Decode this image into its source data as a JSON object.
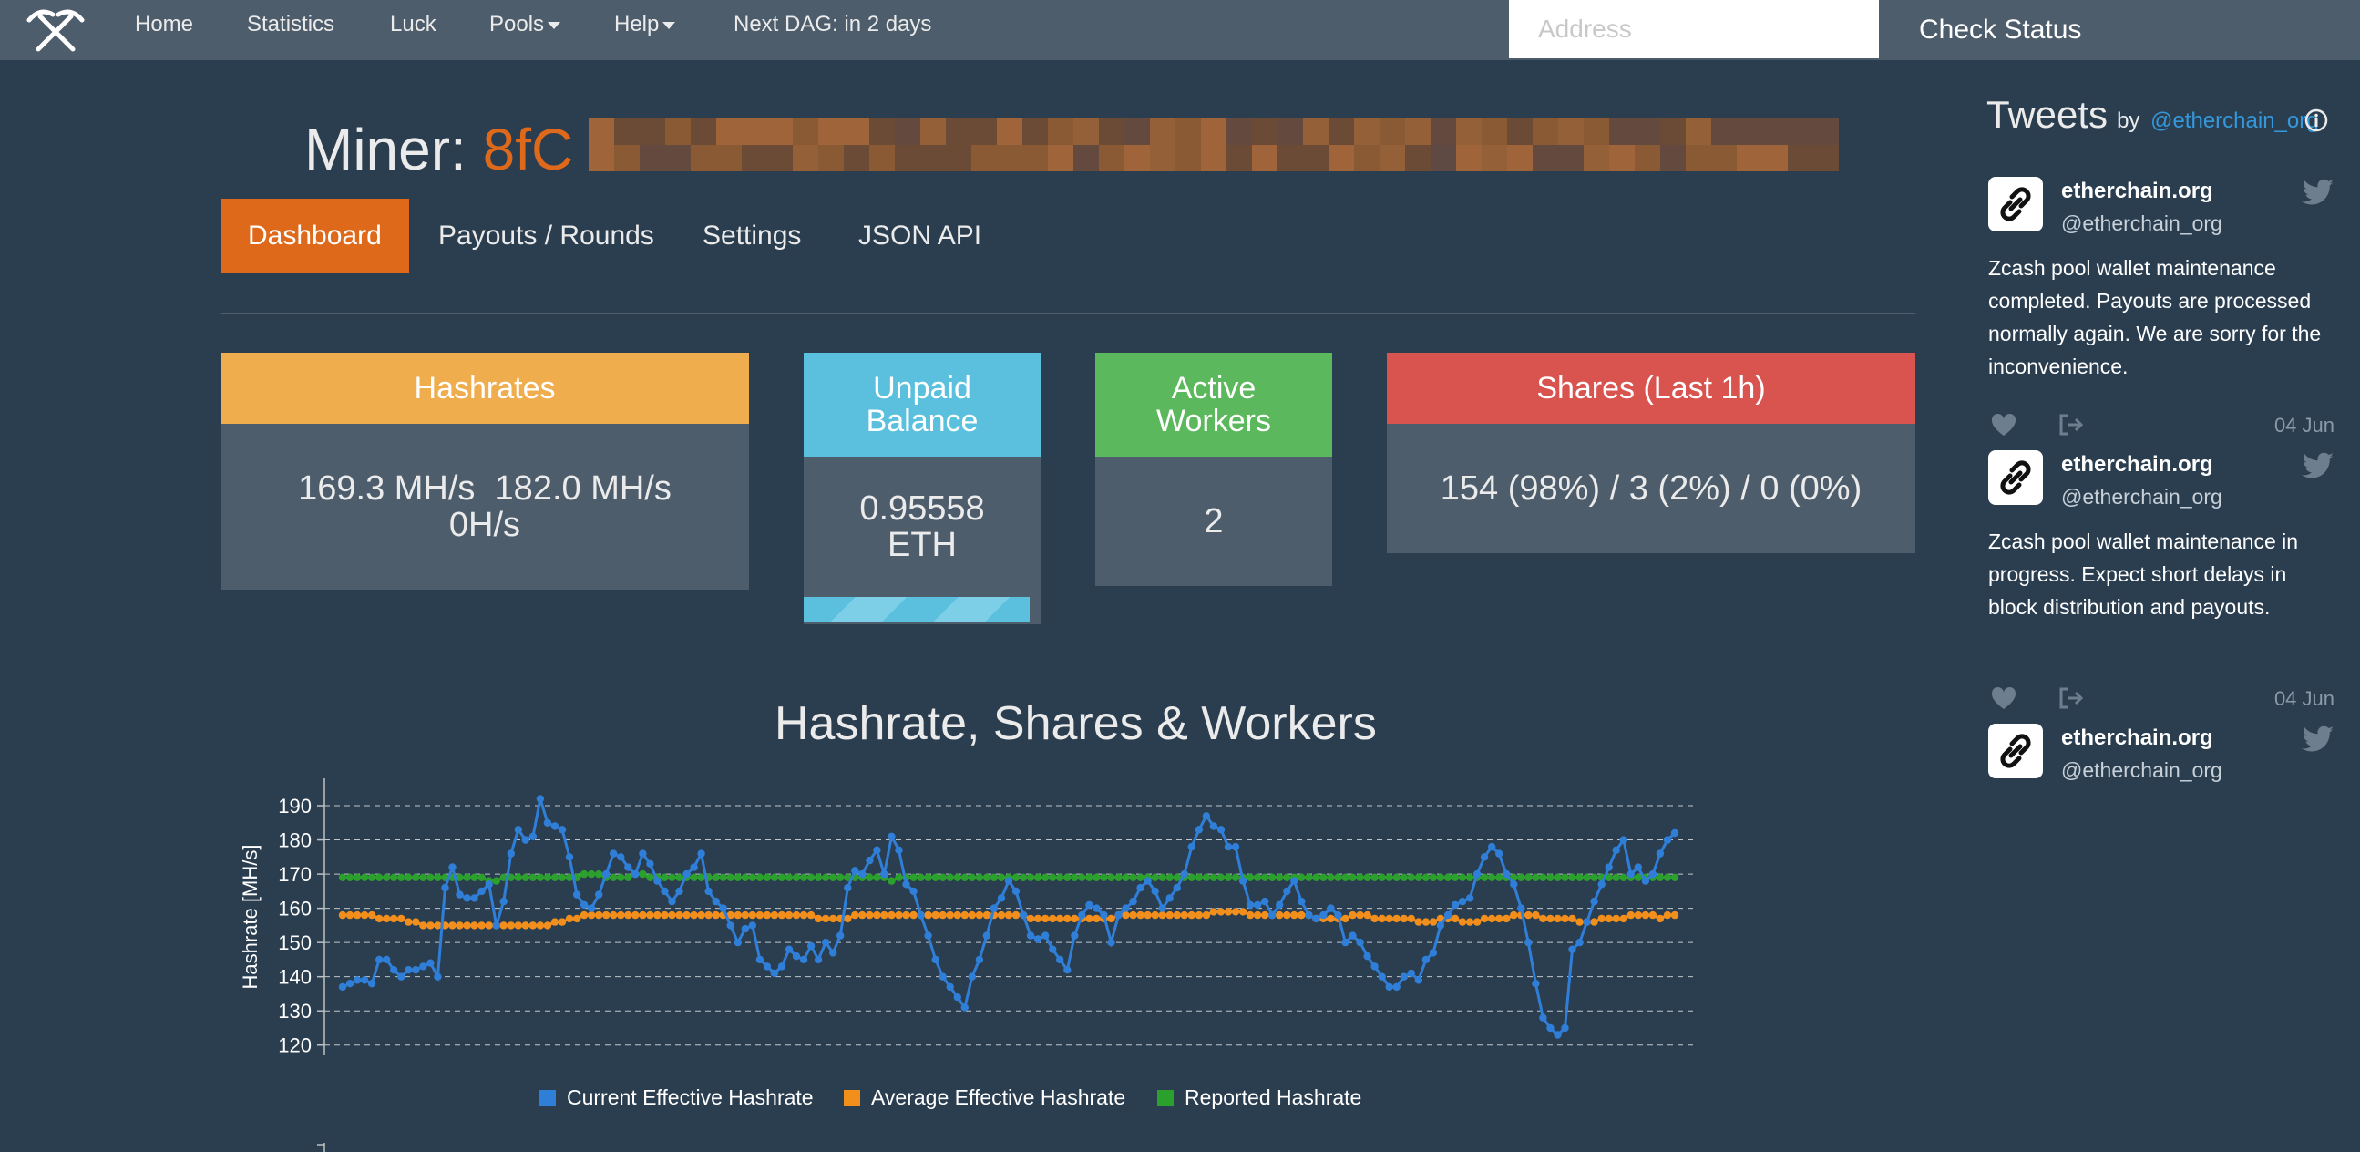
{
  "nav": {
    "logo_icon": "crossed-pickaxes-icon",
    "items": [
      "Home",
      "Statistics",
      "Luck",
      "Pools",
      "Help",
      "Next DAG: in 2 days"
    ],
    "address_placeholder": "Address",
    "check_status": "Check Status"
  },
  "miner": {
    "label": "Miner: ",
    "address_visible": "8fC"
  },
  "tabs": [
    "Dashboard",
    "Payouts / Rounds",
    "Settings",
    "JSON API"
  ],
  "cards": {
    "hashrates": {
      "title": "Hashrates",
      "line1": "169.3 MH/s  182.0 MH/s",
      "line2": "0H/s",
      "color": "#f0ad4e"
    },
    "unpaid": {
      "title_1": "Unpaid",
      "title_2": "Balance",
      "value_1": "0.95558",
      "value_2": "ETH",
      "color": "#5bc0de"
    },
    "workers": {
      "title_1": "Active",
      "title_2": "Workers",
      "value": "2",
      "color": "#5cb85c"
    },
    "shares": {
      "title": "Shares (Last 1h)",
      "value": "154 (98%) / 3 (2%) / 0 (0%)",
      "color": "#d9534f"
    }
  },
  "chart_title": "Hashrate, Shares & Workers",
  "chart_data": {
    "type": "line",
    "ylabel": "Hashrate [MH/s]",
    "xlabel": "",
    "ylim": [
      117,
      198
    ],
    "yticks": [
      120,
      130,
      140,
      150,
      160,
      170,
      180,
      190
    ],
    "grid": true,
    "legend_position": "bottom",
    "series": [
      {
        "name": "Current Effective Hashrate",
        "color": "#2f7ed8",
        "values": [
          137,
          138,
          139,
          139,
          138,
          145,
          145,
          142,
          140,
          142,
          142,
          143,
          144,
          140,
          166,
          172,
          164,
          163,
          163,
          165,
          167,
          155,
          162,
          176,
          183,
          180,
          181,
          192,
          185,
          184,
          183,
          175,
          164,
          161,
          160,
          164,
          170,
          176,
          175,
          172,
          170,
          176,
          173,
          168,
          165,
          162,
          165,
          170,
          172,
          176,
          165,
          162,
          160,
          155,
          150,
          154,
          155,
          145,
          143,
          141,
          143,
          148,
          146,
          145,
          149,
          145,
          150,
          147,
          152,
          166,
          171,
          170,
          174,
          177,
          170,
          181,
          177,
          167,
          165,
          158,
          152,
          145,
          140,
          137,
          134,
          131,
          140,
          145,
          152,
          160,
          163,
          168,
          165,
          158,
          152,
          151,
          152,
          148,
          145,
          142,
          152,
          158,
          161,
          160,
          158,
          150,
          158,
          160,
          162,
          166,
          168,
          165,
          160,
          163,
          166,
          170,
          178,
          183,
          187,
          184,
          183,
          178,
          178,
          168,
          161,
          161,
          162,
          158,
          161,
          165,
          168,
          162,
          158,
          157,
          158,
          160,
          158,
          150,
          152,
          150,
          146,
          143,
          140,
          137,
          137,
          140,
          141,
          139,
          145,
          147,
          155,
          158,
          161,
          162,
          163,
          170,
          175,
          178,
          176,
          170,
          167,
          160,
          150,
          138,
          128,
          125,
          123,
          125,
          148,
          150,
          156,
          162,
          167,
          172,
          177,
          180,
          170,
          172,
          168,
          170,
          176,
          180,
          182
        ]
      },
      {
        "name": "Average Effective Hashrate",
        "color": "#f28f1c",
        "values": [
          158,
          158,
          158,
          158,
          158,
          157,
          157,
          157,
          157,
          156,
          156,
          155,
          155,
          155,
          155,
          155,
          155,
          155,
          155,
          155,
          155,
          155,
          155,
          155,
          155,
          155,
          155,
          155,
          155,
          156,
          156,
          157,
          157,
          158,
          158,
          158,
          158,
          158,
          158,
          158,
          158,
          158,
          158,
          158,
          158,
          158,
          158,
          158,
          158,
          158,
          158,
          158,
          158,
          158,
          158,
          158,
          158,
          158,
          158,
          158,
          158,
          158,
          158,
          158,
          158,
          157,
          157,
          157,
          157,
          157,
          158,
          158,
          158,
          158,
          158,
          158,
          158,
          158,
          158,
          158,
          158,
          158,
          158,
          158,
          158,
          158,
          158,
          158,
          158,
          158,
          158,
          158,
          158,
          158,
          157,
          157,
          157,
          157,
          157,
          157,
          157,
          157,
          157,
          157,
          157,
          157,
          158,
          158,
          158,
          158,
          158,
          158,
          158,
          158,
          158,
          158,
          158,
          158,
          158,
          159,
          159,
          159,
          159,
          159,
          158,
          158,
          158,
          158,
          158,
          158,
          158,
          158,
          158,
          157,
          157,
          157,
          157,
          157,
          158,
          158,
          158,
          157,
          157,
          157,
          157,
          157,
          157,
          156,
          156,
          156,
          157,
          157,
          157,
          156,
          156,
          156,
          157,
          157,
          157,
          157,
          158,
          158,
          158,
          158,
          157,
          157,
          157,
          157,
          157,
          156,
          156,
          156,
          157,
          157,
          157,
          157,
          158,
          158,
          158,
          158,
          157,
          158,
          158
        ]
      },
      {
        "name": "Reported Hashrate",
        "color": "#2ca02c",
        "values": [
          169,
          169,
          169,
          169,
          169,
          169,
          169,
          169,
          169,
          169,
          169,
          169,
          169,
          169,
          169,
          169,
          169,
          169,
          169,
          169,
          168,
          168,
          169,
          169,
          169,
          169,
          169,
          169,
          169,
          169,
          169,
          169,
          169,
          170,
          170,
          170,
          169,
          169,
          169,
          169,
          170,
          170,
          169,
          169,
          169,
          169,
          169,
          169,
          169,
          169,
          169,
          169,
          169,
          169,
          169,
          169,
          169,
          169,
          169,
          169,
          169,
          169,
          169,
          169,
          169,
          169,
          169,
          169,
          169,
          169,
          169,
          169,
          169,
          169,
          169,
          168,
          169,
          169,
          169,
          169,
          169,
          169,
          169,
          169,
          169,
          169,
          169,
          169,
          169,
          169,
          169,
          169,
          169,
          169,
          169,
          169,
          169,
          169,
          169,
          169,
          169,
          169,
          169,
          169,
          169,
          169,
          169,
          169,
          169,
          169,
          169,
          169,
          169,
          169,
          169,
          169,
          169,
          169,
          169,
          169,
          169,
          169,
          169,
          169,
          169,
          169,
          169,
          169,
          169,
          169,
          169,
          169,
          169,
          169,
          169,
          169,
          169,
          169,
          169,
          169,
          169,
          169,
          169,
          169,
          169,
          169,
          169,
          169,
          169,
          169,
          169,
          169,
          169,
          169,
          169,
          169,
          169,
          169,
          169,
          169,
          169,
          169,
          169,
          169,
          169,
          169,
          169,
          169,
          169,
          169,
          169,
          169,
          169,
          169,
          169,
          169,
          169,
          169,
          169,
          169,
          169,
          169,
          169
        ]
      }
    ]
  },
  "tweets_header": {
    "title": "Tweets",
    "by": "by",
    "handle": "@etherchain_org"
  },
  "tweets": [
    {
      "name": "etherchain.org",
      "handle": "@etherchain_org",
      "text": "Zcash pool wallet maintenance completed. Payouts are processed normally again. We are sorry for the inconvenience.",
      "date": "04 Jun"
    },
    {
      "name": "etherchain.org",
      "handle": "@etherchain_org",
      "text": "Zcash pool wallet maintenance in progress. Expect short delays in block distribution and payouts.",
      "date": "04 Jun"
    },
    {
      "name": "etherchain.org",
      "handle": "@etherchain_org",
      "text": "",
      "date": ""
    }
  ]
}
